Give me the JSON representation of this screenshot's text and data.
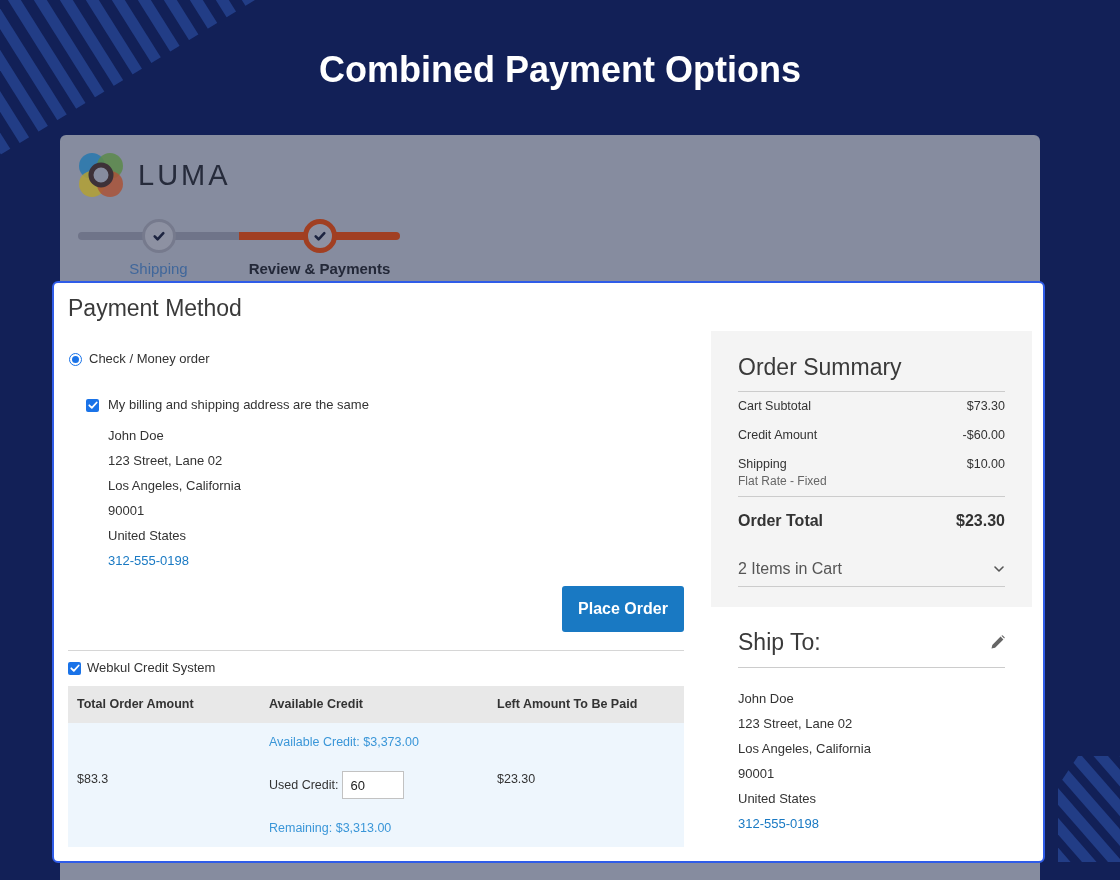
{
  "banner": {
    "title": "Combined Payment Options"
  },
  "store": {
    "logo_text": "LUMA",
    "steps": [
      {
        "label": "Shipping",
        "completed": true,
        "selected": false
      },
      {
        "label": "Review & Payments",
        "completed": true,
        "selected": true
      }
    ]
  },
  "payment_method": {
    "title": "Payment Method",
    "options": [
      {
        "label": "Check / Money order",
        "selected": true
      }
    ],
    "same_address": {
      "label": "My billing and shipping address are the same",
      "checked": true
    },
    "address": [
      "John Doe",
      "123 Street, Lane 02",
      "Los Angeles, California",
      "90001",
      "United States"
    ],
    "phone": "312-555-0198",
    "place_order": "Place Order"
  },
  "credit_system": {
    "label": "Webkul Credit System",
    "checked": true,
    "columns": [
      "Total Order Amount",
      "Available Credit",
      "Left Amount To Be Paid"
    ],
    "row": {
      "total_order_amount": "$83.3",
      "available_credit": "Available Credit: $3,373.00",
      "used_credit_label": "Used Credit:",
      "used_credit_value": "60",
      "remaining": "Remaining: $3,313.00",
      "left_amount": "$23.30"
    }
  },
  "order_summary": {
    "title": "Order Summary",
    "rows": [
      {
        "label": "Cart Subtotal",
        "value": "$73.30"
      },
      {
        "label": "Credit Amount",
        "value": "-$60.00"
      },
      {
        "label": "Shipping",
        "note": "Flat Rate - Fixed",
        "value": "$10.00"
      }
    ],
    "total": {
      "label": "Order Total",
      "value": "$23.30"
    },
    "items": {
      "label": "2 Items in Cart",
      "expanded": false
    }
  },
  "ship_to": {
    "title": "Ship To:",
    "address": [
      "John Doe",
      "123 Street, Lane 02",
      "Los Angeles, California",
      "90001",
      "United States"
    ],
    "phone": "312-555-0198"
  }
}
